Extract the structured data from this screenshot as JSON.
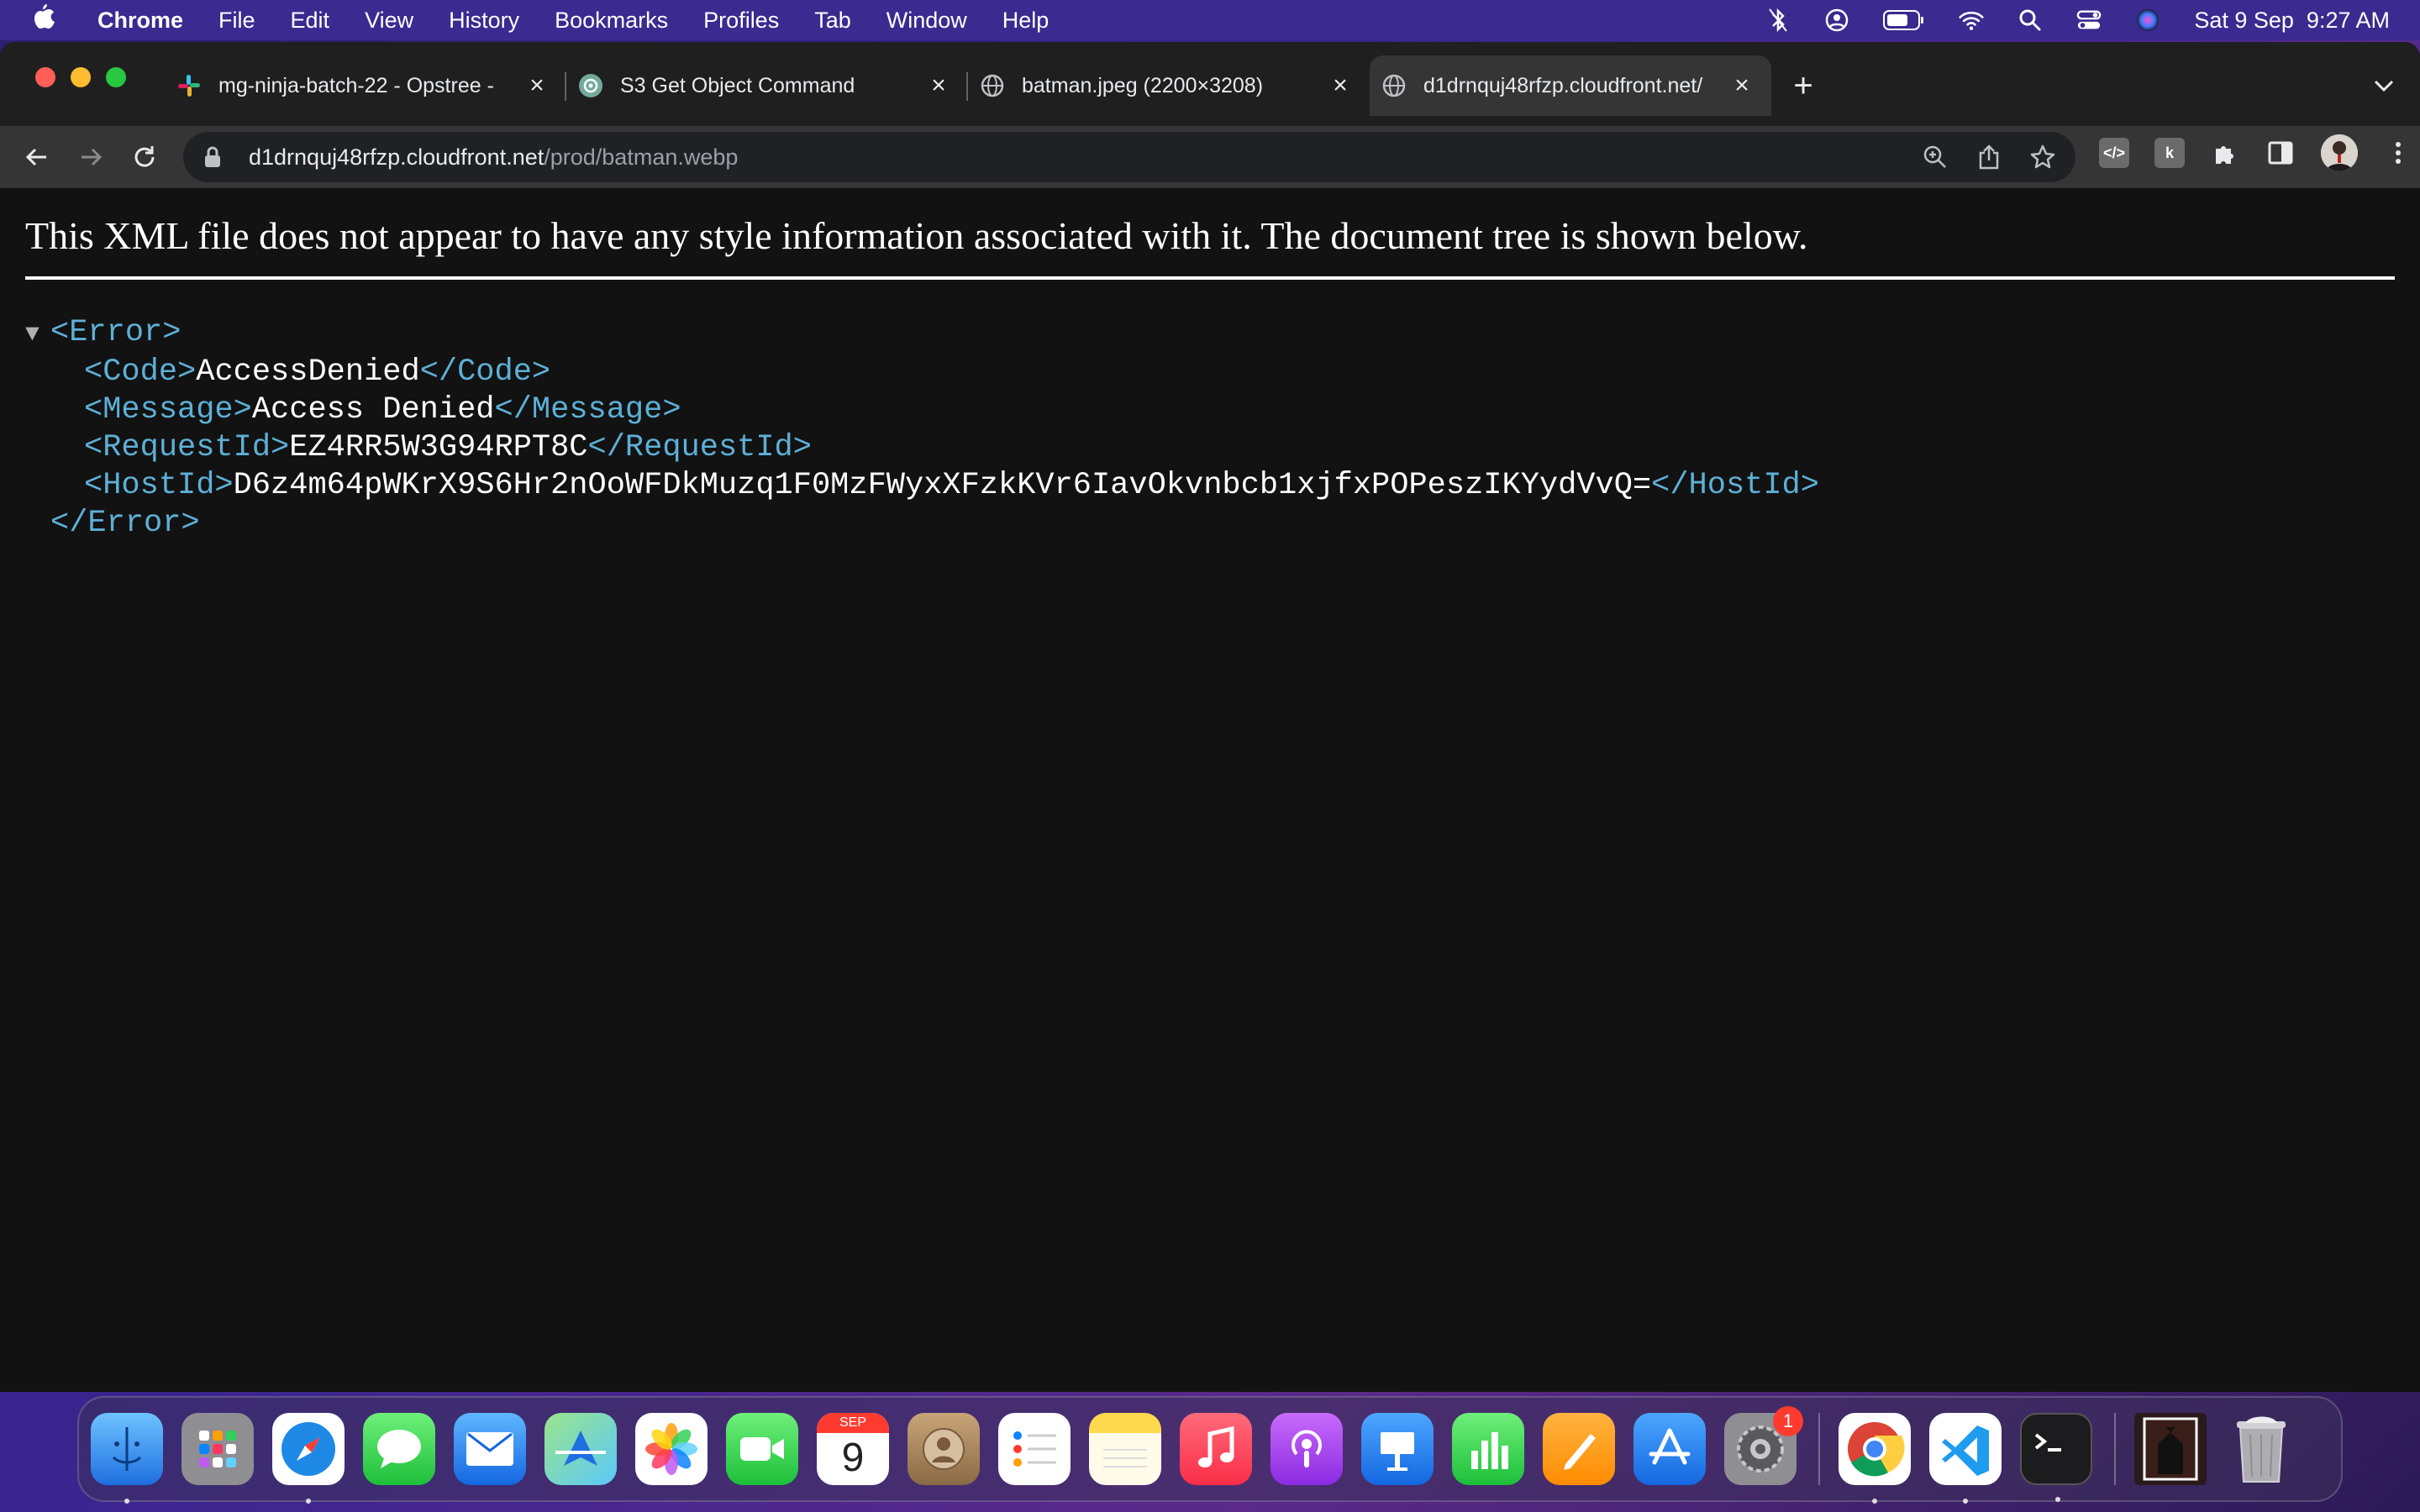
{
  "menubar": {
    "app": "Chrome",
    "items": [
      "File",
      "Edit",
      "View",
      "History",
      "Bookmarks",
      "Profiles",
      "Tab",
      "Window",
      "Help"
    ],
    "clock": "Sat 9 Sep  9:27 AM"
  },
  "tabs": [
    {
      "title": "mg-ninja-batch-22 - Opstree -",
      "icon": "slack-icon"
    },
    {
      "title": "S3 Get Object Command",
      "icon": "chatgpt-icon"
    },
    {
      "title": "batman.jpeg (2200×3208)",
      "icon": "globe-icon"
    },
    {
      "title": "d1drnquj48rfzp.cloudfront.net/",
      "icon": "globe-icon",
      "active": true
    }
  ],
  "omnibox": {
    "host": "d1drnquj48rfzp.cloudfront.net",
    "path": "/prod/batman.webp"
  },
  "xml_notice": "This XML file does not appear to have any style information associated with it. The document tree is shown below.",
  "xml": {
    "root_open": "<Error>",
    "root_close": "</Error>",
    "code": {
      "open": "<Code>",
      "value": "AccessDenied",
      "close": "</Code>"
    },
    "message": {
      "open": "<Message>",
      "value": "Access Denied",
      "close": "</Message>"
    },
    "request_id": {
      "open": "<RequestId>",
      "value": "EZ4RR5W3G94RPT8C",
      "close": "</RequestId>"
    },
    "host_id": {
      "open": "<HostId>",
      "value": "D6z4m64pWKrX9S6Hr2nOoWFDkMuzq1F0MzFWyxXFzkKVr6IavOkvnbcb1xjfxPOPeszIKYydVvQ=",
      "close": "</HostId>"
    }
  },
  "dock": {
    "calendar_month": "SEP",
    "calendar_day": "9",
    "settings_badge": "1"
  },
  "colors": {
    "tag": "#5db0d7",
    "background": "#121212",
    "tabstrip": "#1f1f1f",
    "toolbar": "#353535"
  }
}
